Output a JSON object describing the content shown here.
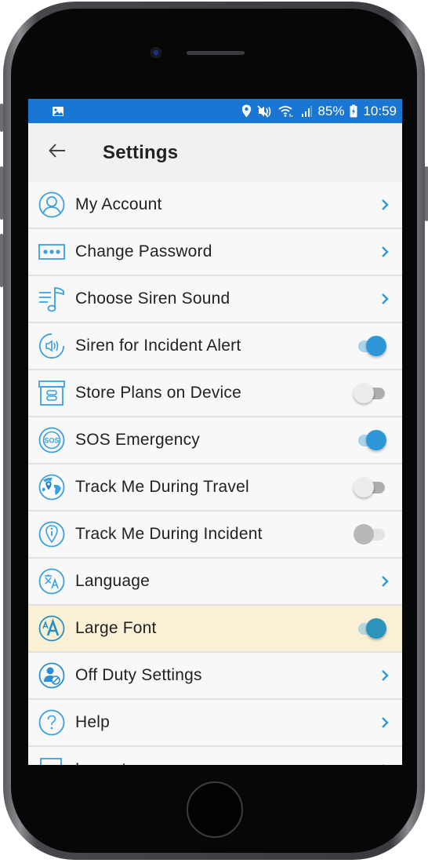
{
  "status_bar": {
    "battery": "85%",
    "time": "10:59",
    "icons": [
      "image-icon",
      "location-icon",
      "mute-icon",
      "wifi-icon",
      "signal-icon",
      "battery-charging-icon"
    ]
  },
  "app_bar": {
    "title": "Settings",
    "back_icon": "arrow-left-icon"
  },
  "colors": {
    "accent": "#2b97d9",
    "status_bar": "#1976d2",
    "highlight_row": "#f9f0d6",
    "icon": "#3aa0e0"
  },
  "settings": [
    {
      "label": "My Account",
      "icon": "user-circle-icon",
      "control": "chevron"
    },
    {
      "label": "Change Password",
      "icon": "password-dots-icon",
      "control": "chevron"
    },
    {
      "label": "Choose Siren Sound",
      "icon": "music-list-icon",
      "control": "chevron"
    },
    {
      "label": "Siren for Incident Alert",
      "icon": "speaker-icon",
      "control": "toggle",
      "state": "on"
    },
    {
      "label": "Store Plans on Device",
      "icon": "archive-box-icon",
      "control": "toggle",
      "state": "off"
    },
    {
      "label": "SOS Emergency",
      "icon": "sos-icon",
      "control": "toggle",
      "state": "on"
    },
    {
      "label": "Track Me During Travel",
      "icon": "globe-pin-icon",
      "control": "toggle",
      "state": "off"
    },
    {
      "label": "Track Me During Incident",
      "icon": "info-pin-icon",
      "control": "toggle",
      "state": "disabled"
    },
    {
      "label": "Language",
      "icon": "translate-icon",
      "control": "chevron"
    },
    {
      "label": "Large Font",
      "icon": "font-size-icon",
      "control": "toggle",
      "state": "on",
      "highlighted": true
    },
    {
      "label": "Off Duty Settings",
      "icon": "user-blocked-icon",
      "control": "chevron"
    },
    {
      "label": "Help",
      "icon": "help-icon",
      "control": "chevron"
    },
    {
      "label": "Logout",
      "icon": "logout-icon",
      "control": "chevron"
    }
  ]
}
